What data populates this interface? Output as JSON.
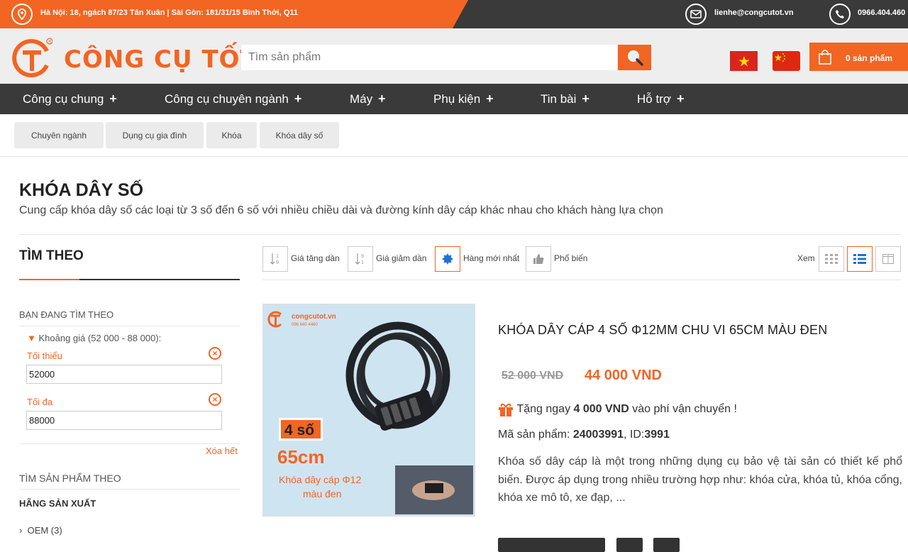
{
  "topbar": {
    "address": "Hà Nội: 18, ngách 87/23 Tân Xuân | Sài Gòn: 181/31/15 Bình Thới, Q11",
    "email": "lienhe@congcutot.vn",
    "phone": "0966.404.460"
  },
  "header": {
    "logo_text": "CÔNG CỤ TỐT",
    "search_placeholder": "Tìm sản phẩm",
    "cart_label": "0 sản phẩm",
    "brand_color": "#f26522"
  },
  "nav": {
    "items": [
      {
        "label": "Công cụ chung"
      },
      {
        "label": "Công cụ chuyên ngành"
      },
      {
        "label": "Máy"
      },
      {
        "label": "Phụ kiện"
      },
      {
        "label": "Tin bài"
      },
      {
        "label": "Hỗ trợ"
      }
    ],
    "plus": "+"
  },
  "breadcrumb": [
    "Chuyên ngành",
    "Dụng cụ gia đình",
    "Khóa",
    "Khóa dây số"
  ],
  "category": {
    "title": "KHÓA DÂY SỐ",
    "description": "Cung cấp khóa dây số các loại từ 3 số đến 6 số với nhiều chiều dài và đường kính dây cáp khác nhau cho khách hàng lựa chọn"
  },
  "sidebar": {
    "title": "TÌM THEO",
    "current_heading": "BẠN ĐANG TÌM THEO",
    "price_range": "Khoảng giá (52 000 - 88 000):",
    "min_label": "Tối thiểu",
    "min_value": "52000",
    "max_label": "Tối đa",
    "max_value": "88000",
    "clear_label": "Xóa hết",
    "find_heading": "TÌM SẢN PHẨM THEO",
    "brand_heading": "HÃNG SẢN XUẤT",
    "brand_item": "OEM (3)"
  },
  "toolbar": {
    "sort_asc": "Giá tăng dần",
    "sort_desc": "Giá giảm dần",
    "sort_new": "Hàng mới nhất",
    "sort_popular": "Phổ biến",
    "view_label": "Xem",
    "active_sort": "Hàng mới nhất",
    "active_view": "list"
  },
  "product": {
    "name": "KHÓA DÂY CÁP 4 SỐ Φ12MM CHU VI 65CM MÀU ĐEN",
    "old_price": "52 000 VND",
    "new_price": "44 000 VND",
    "gift_prefix": "Tặng ngay",
    "gift_amount": "4 000 VND",
    "gift_suffix": "vào phí vận chuyển !",
    "sku_label": "Mã sản phẩm:",
    "sku": "24003991",
    "id_label": ", ID:",
    "id": "3991",
    "short_description": "Khóa số dây cáp là một trong những dụng cụ bảo vệ tài sản có thiết kế phổ biến. Được áp dụng trong nhiều trường hợp như: khóa cửa, khóa tủ, khóa cổng, khóa xe mô tô, xe đạp, ...",
    "image": {
      "brand": "congcutot.vn",
      "phone": "096 640 4460",
      "badge": "4 số",
      "length": "65cm",
      "caption_line1": "Khóa dây cáp Φ12",
      "caption_line2": "màu đen"
    }
  }
}
